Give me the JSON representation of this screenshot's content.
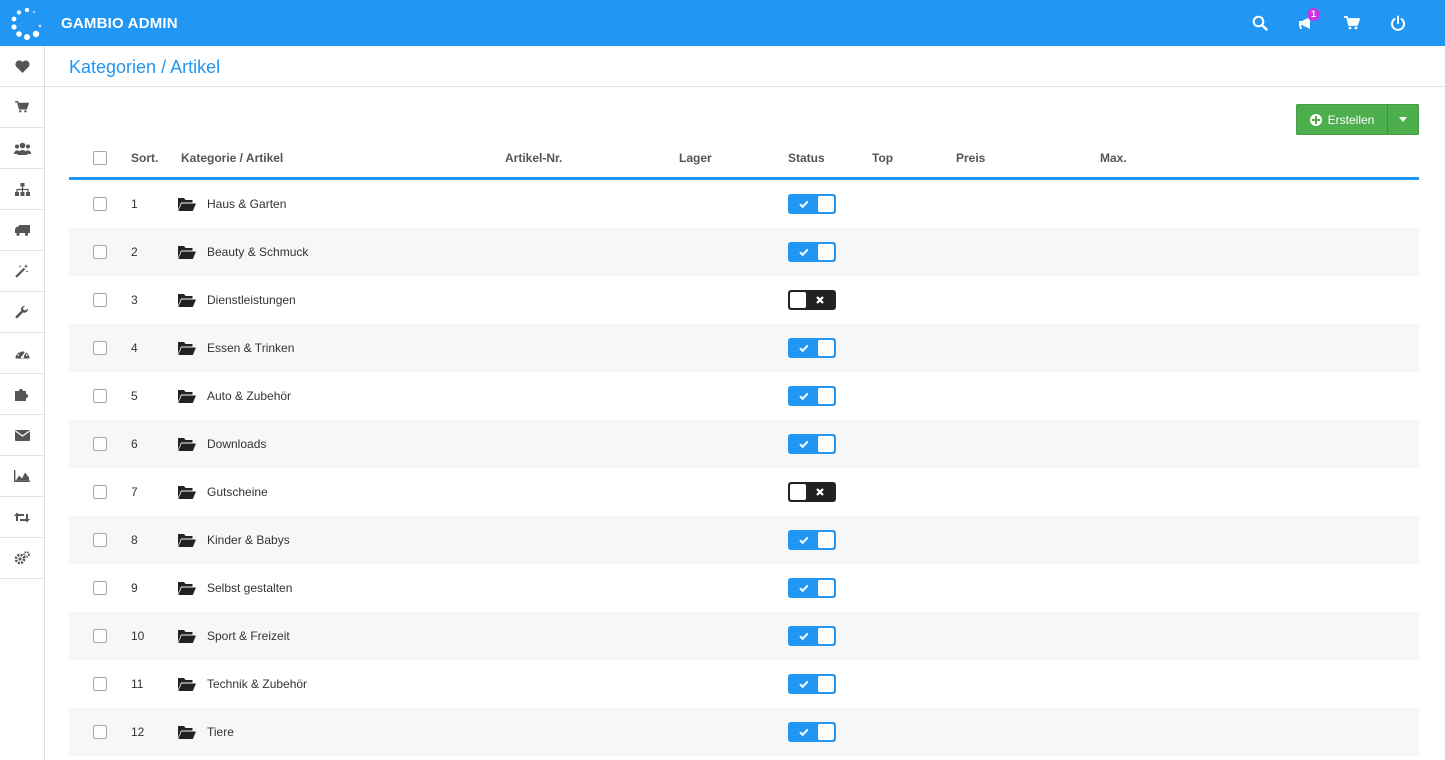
{
  "app": {
    "brand": "GAMBIO ADMIN",
    "accent_color": "#2196f3",
    "notification_count": "1"
  },
  "topbar": {
    "icons": [
      "search-icon",
      "megaphone-icon",
      "cart-icon",
      "power-icon"
    ]
  },
  "sidebar": {
    "items": [
      {
        "icon": "heart-icon"
      },
      {
        "icon": "cart-icon"
      },
      {
        "icon": "users-icon"
      },
      {
        "icon": "sitemap-icon"
      },
      {
        "icon": "truck-icon"
      },
      {
        "icon": "magic-wand-icon"
      },
      {
        "icon": "wrench-icon"
      },
      {
        "icon": "dashboard-icon"
      },
      {
        "icon": "puzzle-icon"
      },
      {
        "icon": "envelope-icon"
      },
      {
        "icon": "area-chart-icon"
      },
      {
        "icon": "retweet-icon"
      },
      {
        "icon": "cogs-icon"
      }
    ]
  },
  "page": {
    "title": "Kategorien / Artikel"
  },
  "toolbar": {
    "create_label": "Erstellen"
  },
  "table": {
    "headers": {
      "sort": "Sort.",
      "category": "Kategorie / Artikel",
      "article_no": "Artikel-Nr.",
      "stock": "Lager",
      "status": "Status",
      "top": "Top",
      "price": "Preis",
      "max": "Max."
    },
    "rows": [
      {
        "sort": "1",
        "name": "Haus & Garten",
        "status": true
      },
      {
        "sort": "2",
        "name": "Beauty & Schmuck",
        "status": true
      },
      {
        "sort": "3",
        "name": "Dienstleistungen",
        "status": false
      },
      {
        "sort": "4",
        "name": "Essen & Trinken",
        "status": true
      },
      {
        "sort": "5",
        "name": "Auto & Zubehör",
        "status": true
      },
      {
        "sort": "6",
        "name": "Downloads",
        "status": true
      },
      {
        "sort": "7",
        "name": "Gutscheine",
        "status": false
      },
      {
        "sort": "8",
        "name": "Kinder & Babys",
        "status": true
      },
      {
        "sort": "9",
        "name": "Selbst gestalten",
        "status": true
      },
      {
        "sort": "10",
        "name": "Sport & Freizeit",
        "status": true
      },
      {
        "sort": "11",
        "name": "Technik & Zubehör",
        "status": true
      },
      {
        "sort": "12",
        "name": "Tiere",
        "status": true
      }
    ]
  }
}
